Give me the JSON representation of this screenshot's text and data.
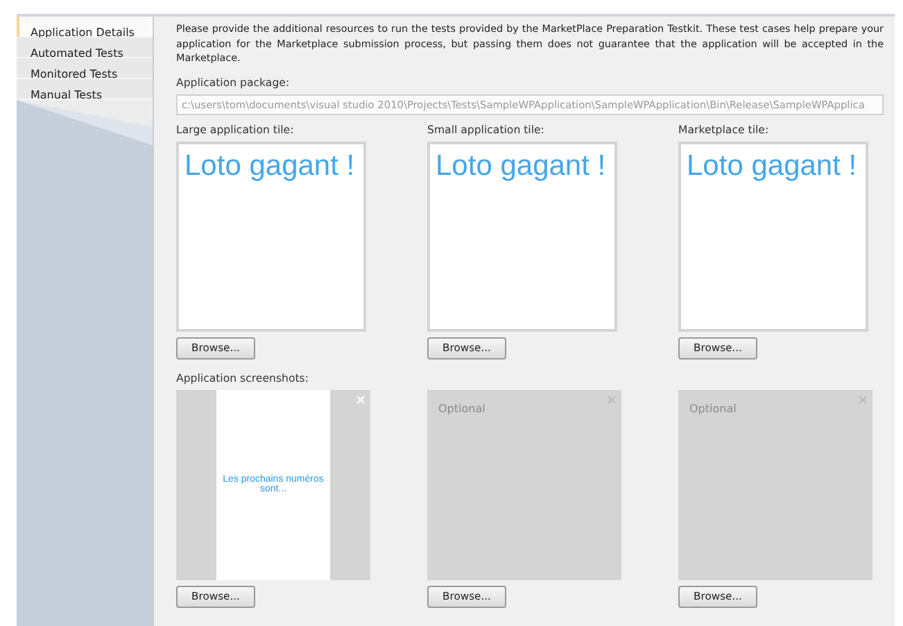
{
  "sidebar": {
    "tabs": [
      {
        "label": "Application Details",
        "selected": true
      },
      {
        "label": "Automated Tests",
        "selected": false
      },
      {
        "label": "Monitored Tests",
        "selected": false
      },
      {
        "label": "Manual Tests",
        "selected": false
      }
    ]
  },
  "intro": "Please provide the additional resources to run the tests provided by the MarketPlace Preparation Testkit. These test cases help prepare your application for the Marketplace submission process, but passing them does not guarantee that the application will be accepted in the Marketplace.",
  "package": {
    "label": "Application package:",
    "value": "c:\\users\\tom\\documents\\visual studio 2010\\Projects\\Tests\\SampleWPApplication\\SampleWPApplication\\Bin\\Release\\SampleWPApplica"
  },
  "tiles": [
    {
      "label": "Large application tile:",
      "text": "Loto gagant !",
      "button": "Browse..."
    },
    {
      "label": "Small application tile:",
      "text": "Loto gagant !",
      "button": "Browse..."
    },
    {
      "label": "Marketplace tile:",
      "text": "Loto gagant !",
      "button": "Browse..."
    }
  ],
  "screenshots": {
    "label": "Application screenshots:",
    "items": [
      {
        "kind": "image",
        "text": "Les prochains numéros sont...",
        "button": "Browse..."
      },
      {
        "kind": "empty",
        "placeholder": "Optional",
        "button": "Browse..."
      },
      {
        "kind": "empty",
        "placeholder": "Optional",
        "button": "Browse..."
      }
    ]
  }
}
